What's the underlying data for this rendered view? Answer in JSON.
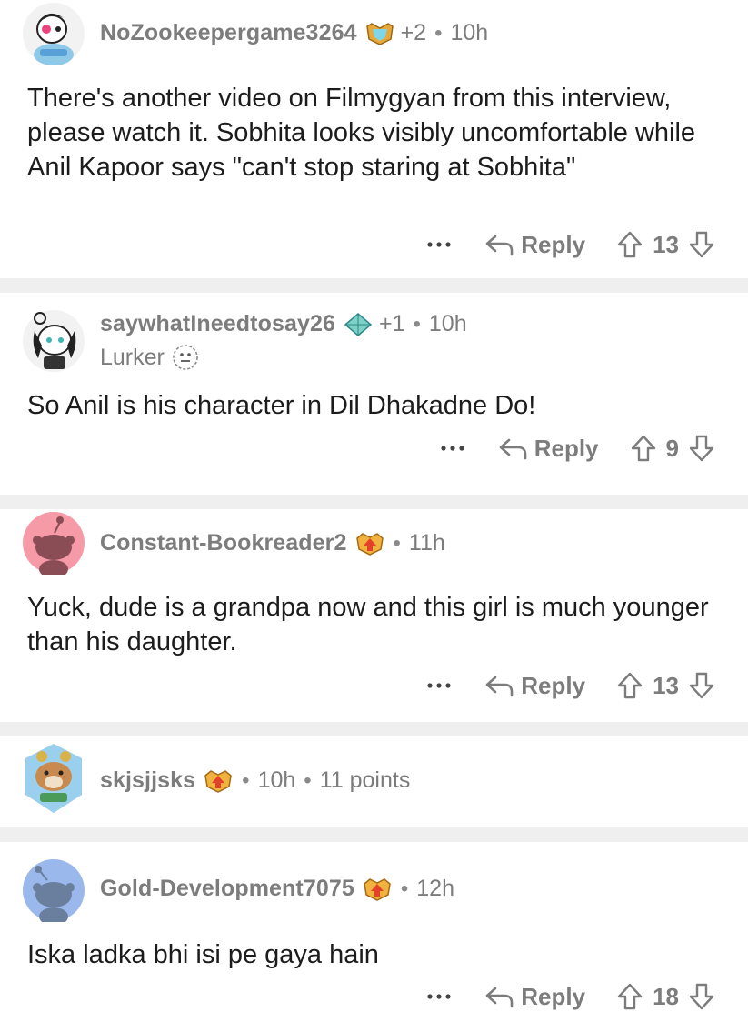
{
  "actions": {
    "reply_label": "Reply",
    "more_icon": "ellipsis-icon",
    "upvote_icon": "upvote-arrow-icon",
    "downvote_icon": "downvote-arrow-icon",
    "reply_icon": "reply-arrow-icon"
  },
  "comments": [
    {
      "username": "NoZookeepergame3264",
      "badge": "achievement-badge-icon",
      "plus": "+2",
      "age": "10h",
      "body": "There's another video on Filmygyan from this interview, please watch it. Sobhita looks visibly uncomfortable while Anil Kapoor says \"can't stop staring at Sobhita\"",
      "votes": "13"
    },
    {
      "username": "saywhatIneedtosay26",
      "badge": "diamond-badge-icon",
      "plus": "+1",
      "age": "10h",
      "flair": "Lurker",
      "body": "So Anil is his character in Dil Dhakadne Do!",
      "votes": "9"
    },
    {
      "username": "Constant-Bookreader2",
      "badge": "crest-badge-icon",
      "age": "11h",
      "body": "Yuck, dude is a grandpa now and this girl is much younger than his daughter.",
      "votes": "13"
    },
    {
      "username": "skjsjjsks",
      "badge": "crest-badge-icon",
      "age": "10h",
      "points": "11 points"
    },
    {
      "username": "Gold-Development7075",
      "badge": "crest-badge-icon",
      "age": "12h",
      "body": "Iska ladka bhi isi pe gaya hain",
      "votes": "18"
    }
  ],
  "colors": {
    "muted": "#7c7c7c",
    "separator": "#efefef",
    "text": "#1c1c1c"
  }
}
